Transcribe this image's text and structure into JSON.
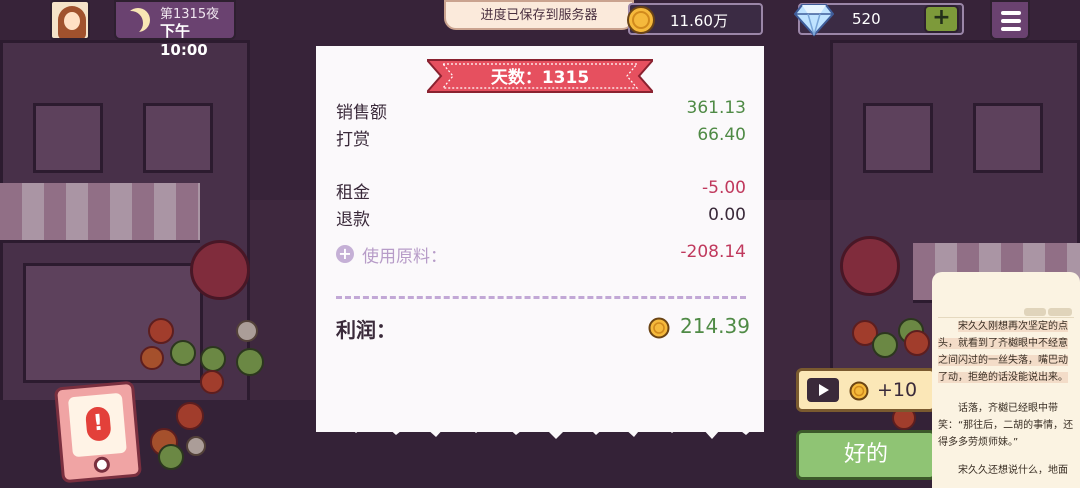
{
  "header": {
    "day_label": "第1315夜",
    "time": "下午10:00",
    "toast": "进度已保存到服务器",
    "coins": "11.60万",
    "gems": "520",
    "plus_label": "+"
  },
  "receipt": {
    "title": "天数：1315",
    "rows": [
      {
        "label": "销售额",
        "value": "361.13"
      },
      {
        "label": "打赏",
        "value": "66.40"
      },
      {
        "label": "租金",
        "value": "-5.00"
      },
      {
        "label": "退款",
        "value": "0.00"
      },
      {
        "label": "使用原料：",
        "value": "-208.14"
      }
    ],
    "profit_label": "利润：",
    "profit_value": "214.39"
  },
  "actions": {
    "ad_reward": "+10",
    "ok_label": "好的"
  },
  "reader": {
    "paragraphs": [
      "宋久久刚想再次坚定的点头，就看到了齐樾眼中不经意之间闪过的一丝失落，嘴巴动了动，拒绝的话没能说出来。",
      "话落，齐樾已经眼中带笑：“那往后，二胡的事情，还得多多劳烦师妹。”",
      "宋久久还想说什么，地面"
    ]
  },
  "colors": {
    "positive": "#4f8a45",
    "negative": "#c0395d",
    "ribbon": "#e6505f",
    "accent_purple": "#6a4270"
  }
}
